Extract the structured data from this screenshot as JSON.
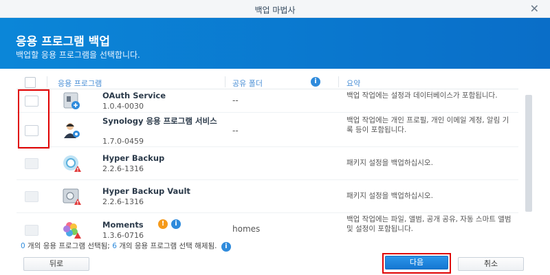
{
  "window": {
    "title": "백업 마법사",
    "close_glyph": "✕"
  },
  "header": {
    "title": "응용 프로그램 백업",
    "subtitle": "백업할 응용 프로그램을 선택합니다."
  },
  "table": {
    "headers": {
      "app": "응용 프로그램",
      "folder": "공유 폴더",
      "summary": "요약"
    },
    "rows": [
      {
        "name": "OAuth Service",
        "version": "1.0.4-0030",
        "folder": "--",
        "summary": "백업 작업에는 설정과 데이터베이스가 포함됩니다.",
        "icon": "oauth-icon"
      },
      {
        "name": "Synology 응용 프로그램 서비스",
        "version": "1.7.0-0459",
        "folder": "--",
        "summary": "백업 작업에는 개인 프로필, 개인 이메일 계정, 알림 기록 등이 포함됩니다.",
        "icon": "synology-app-service-icon"
      },
      {
        "name": "Hyper Backup",
        "version": "2.2.6-1316",
        "folder": "",
        "summary": "패키지 설정을 백업하십시오.",
        "icon": "hyper-backup-icon"
      },
      {
        "name": "Hyper Backup Vault",
        "version": "2.2.6-1316",
        "folder": "",
        "summary": "패키지 설정을 백업하십시오.",
        "icon": "hyper-backup-vault-icon"
      },
      {
        "name": "Moments",
        "version": "1.3.6-0716",
        "folder": "homes",
        "summary": "백업 작업에는 파일, 앨범, 공개 공유, 자동 스마트 앨범 및 설정이 포함됩니다.",
        "icon": "moments-icon"
      }
    ]
  },
  "status": {
    "selected_count": "0",
    "selected_text": "개의 응용 프로그램 선택됨;",
    "unselected_count": "6",
    "unselected_text": "개의 응용 프로그램 선택 해제됨."
  },
  "buttons": {
    "back": "뒤로",
    "next": "다음",
    "cancel": "취소"
  },
  "colors": {
    "accent": "#0a7fd6",
    "highlight": "#e00000"
  }
}
